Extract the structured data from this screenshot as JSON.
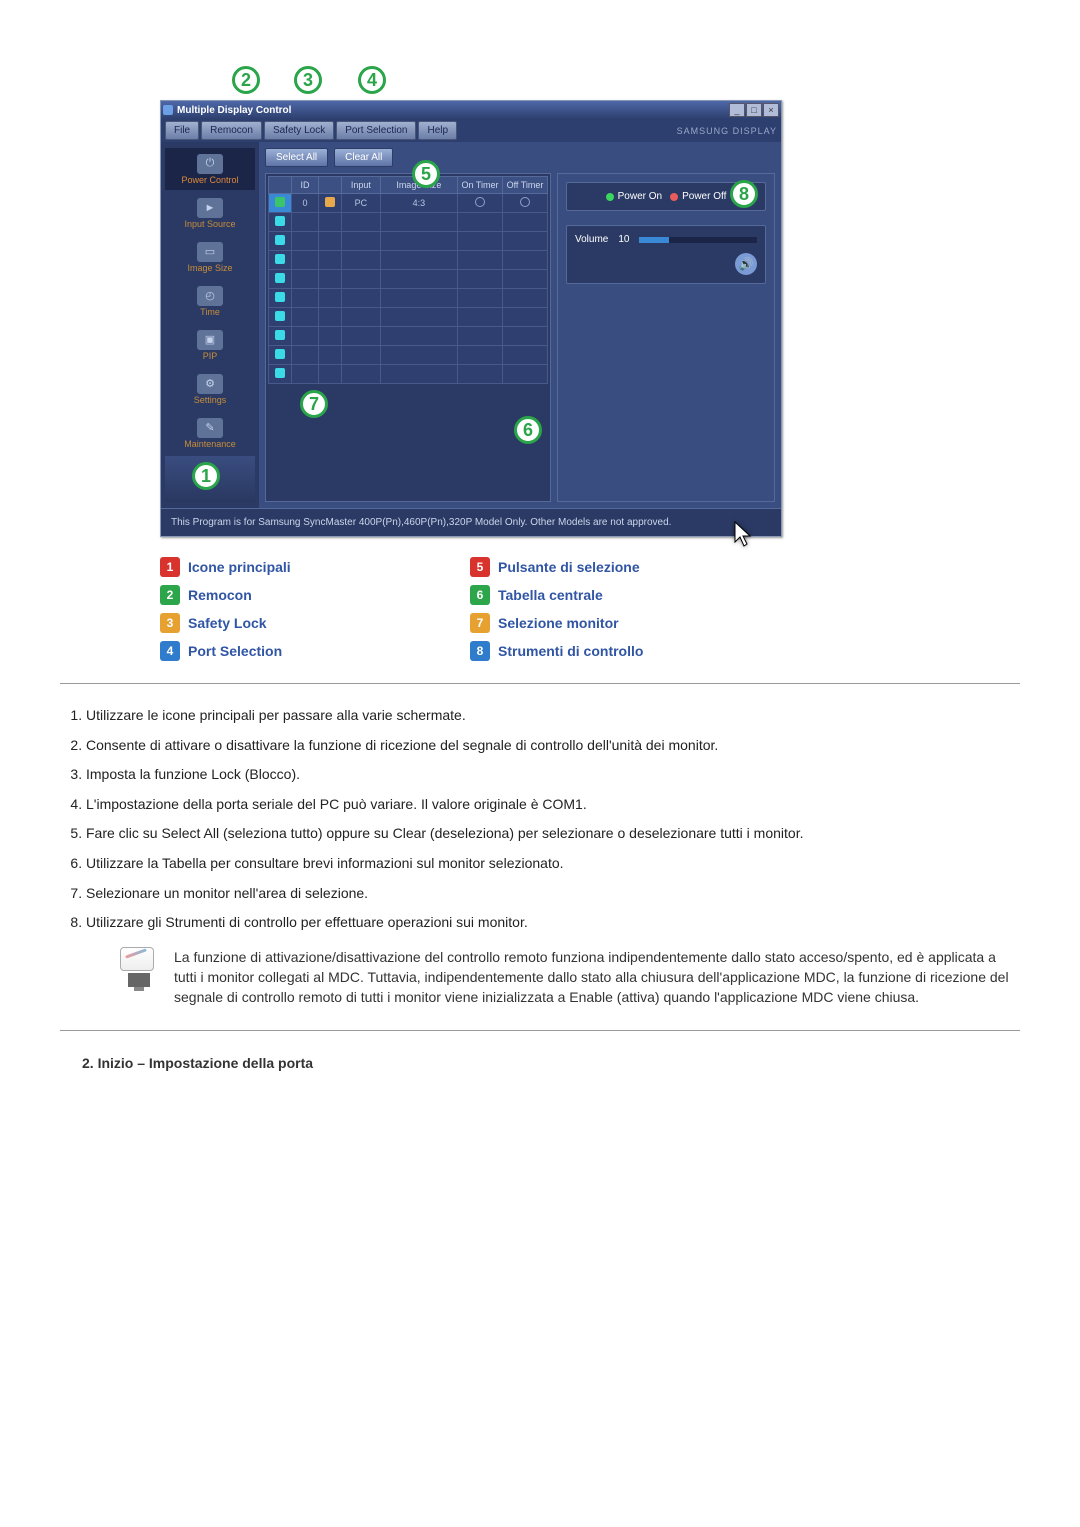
{
  "app": {
    "title": "Multiple Display Control",
    "brand_text": "SAMSUNG DISPLAY",
    "window_buttons": {
      "min": "_",
      "max": "□",
      "close": "×"
    },
    "menu": [
      "File",
      "Remocon",
      "Safety Lock",
      "Port Selection",
      "Help"
    ],
    "toolbar": {
      "select_all": "Select All",
      "clear_all": "Clear All"
    },
    "sidebar": [
      {
        "label": "Power Control",
        "icon_glyph": "⏻"
      },
      {
        "label": "Input Source",
        "icon_glyph": "►"
      },
      {
        "label": "Image Size",
        "icon_glyph": "▭"
      },
      {
        "label": "Time",
        "icon_glyph": "◴"
      },
      {
        "label": "PIP",
        "icon_glyph": "▣"
      },
      {
        "label": "Settings",
        "icon_glyph": "⚙"
      },
      {
        "label": "Maintenance",
        "icon_glyph": "✎"
      }
    ],
    "grid": {
      "headers": [
        "",
        "ID",
        "",
        "Input",
        "Image Size",
        "On Timer",
        "Off Timer"
      ],
      "first_row": {
        "id": "0",
        "input": "PC",
        "image_size": "4:3"
      }
    },
    "right_panel": {
      "power_on": "Power On",
      "power_off": "Power Off",
      "volume_label": "Volume",
      "volume_value": "10",
      "speaker_icon": "🔊"
    },
    "status_text": "This Program is for Samsung SyncMaster 400P(Pn),460P(Pn),320P  Model Only. Other Models are not approved."
  },
  "callouts": {
    "c1": "1",
    "c2": "2",
    "c3": "3",
    "c4": "4",
    "c5": "5",
    "c6": "6",
    "c7": "7",
    "c8": "8"
  },
  "legend": {
    "left": [
      {
        "num": "1",
        "text": "Icone principali"
      },
      {
        "num": "2",
        "text": "Remocon"
      },
      {
        "num": "3",
        "text": "Safety Lock"
      },
      {
        "num": "4",
        "text": "Port Selection"
      }
    ],
    "right": [
      {
        "num": "5",
        "text": "Pulsante di selezione"
      },
      {
        "num": "6",
        "text": "Tabella centrale"
      },
      {
        "num": "7",
        "text": "Selezione monitor"
      },
      {
        "num": "8",
        "text": "Strumenti di controllo"
      }
    ]
  },
  "steps": [
    "Utilizzare le icone principali per passare alla varie schermate.",
    "Consente di attivare o disattivare la funzione di ricezione del segnale di controllo dell'unità dei monitor.",
    "Imposta la funzione Lock (Blocco).",
    "L'impostazione della porta seriale del PC può variare. Il valore originale è COM1.",
    "Fare clic su Select All (seleziona tutto) oppure su Clear (deseleziona) per selezionare o deselezionare tutti i monitor.",
    "Utilizzare la Tabella per consultare brevi informazioni sul monitor selezionato.",
    "Selezionare un monitor nell'area di selezione.",
    "Utilizzare gli Strumenti di controllo per effettuare operazioni sui monitor."
  ],
  "note": "La funzione di attivazione/disattivazione del controllo remoto funziona indipendentemente dallo stato acceso/spento, ed è applicata a tutti i monitor collegati al MDC. Tuttavia, indipendentemente dallo stato alla chiusura dell'applicazione MDC, la funzione di ricezione del segnale di controllo remoto di tutti i monitor viene inizializzata a Enable (attiva) quando l'applicazione MDC viene chiusa.",
  "section2_title": "2. Inizio – Impostazione della porta"
}
